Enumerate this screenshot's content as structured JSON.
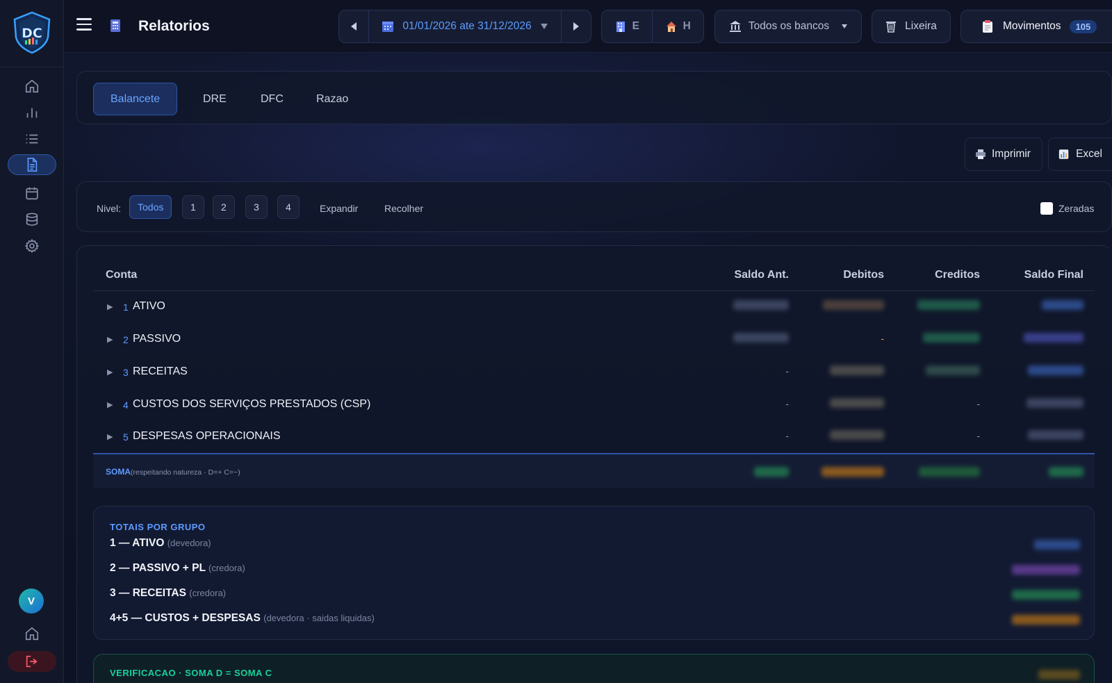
{
  "header": {
    "title": "Relatorios",
    "date_range": "01/01/2026 ate 31/12/2026",
    "view_e": "E",
    "view_h": "H",
    "banks": "Todos os bancos",
    "trash": "Lixeira",
    "movements": "Movimentos",
    "movements_count": "105"
  },
  "tabs": [
    "Balancete",
    "DRE",
    "DFC",
    "Razao"
  ],
  "actions": {
    "print": "Imprimir",
    "excel": "Excel"
  },
  "filters": {
    "level_label": "Nivel:",
    "levels": [
      "Todos",
      "1",
      "2",
      "3",
      "4"
    ],
    "expand": "Expandir",
    "collapse": "Recolher",
    "zeroed": "Zeradas"
  },
  "table": {
    "columns": [
      "Conta",
      "Saldo Ant.",
      "Debitos",
      "Creditos",
      "Saldo Final"
    ],
    "rows": [
      {
        "code": "1",
        "name": "ATIVO",
        "saldo_ant": "",
        "debitos": "",
        "creditos": "",
        "saldo_final": ""
      },
      {
        "code": "2",
        "name": "PASSIVO",
        "saldo_ant": "",
        "debitos": "-",
        "creditos": "",
        "saldo_final": ""
      },
      {
        "code": "3",
        "name": "RECEITAS",
        "saldo_ant": "-",
        "debitos": "",
        "creditos": "",
        "saldo_final": ""
      },
      {
        "code": "4",
        "name": "CUSTOS DOS SERVIÇOS PRESTADOS (CSP)",
        "saldo_ant": "-",
        "debitos": "",
        "creditos": "-",
        "saldo_final": ""
      },
      {
        "code": "5",
        "name": "DESPESAS OPERACIONAIS",
        "saldo_ant": "-",
        "debitos": "",
        "creditos": "-",
        "saldo_final": ""
      }
    ],
    "soma_label": "SOMA",
    "soma_note": "(respeitando natureza · D=+ C=−)"
  },
  "groups": {
    "title": "TOTAIS POR GRUPO",
    "rows": [
      {
        "label": "1 — ATIVO",
        "note": "(devedora)"
      },
      {
        "label": "2 — PASSIVO + PL",
        "note": "(credora)"
      },
      {
        "label": "3 — RECEITAS",
        "note": "(credora)"
      },
      {
        "label": "4+5 — CUSTOS + DESPESAS",
        "note": "(devedora · saidas liquidas)"
      }
    ]
  },
  "verification": {
    "title": "VERIFICACAO · SOMA D = SOMA C"
  },
  "user": {
    "initial": "V"
  },
  "colors": {
    "accent": "#5d9bff",
    "success": "#18d29a",
    "danger": "#ff5a6e"
  }
}
